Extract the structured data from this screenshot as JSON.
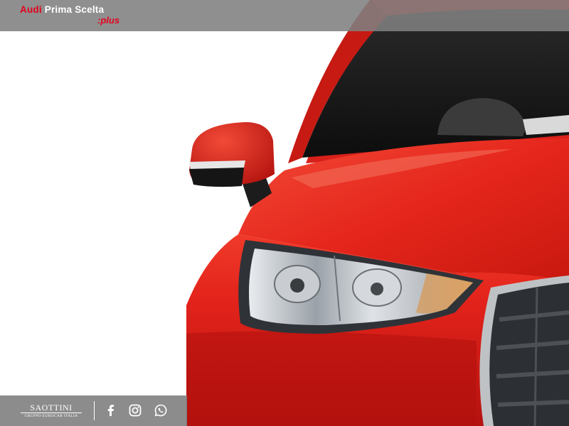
{
  "header": {
    "brand_audi": "Audi",
    "brand_rest": " Prima Scelta",
    "brand_suffix": ":plus",
    "accent_color": "#e3001b"
  },
  "footer": {
    "dealer_name": "SAOTTINI",
    "dealer_group": "GRUPPO EUROCAR ITALIA",
    "social_icons": [
      "facebook-icon",
      "instagram-icon",
      "whatsapp-icon"
    ]
  },
  "hero": {
    "subject": "car-front-detail",
    "car_color": "#e0201a"
  }
}
